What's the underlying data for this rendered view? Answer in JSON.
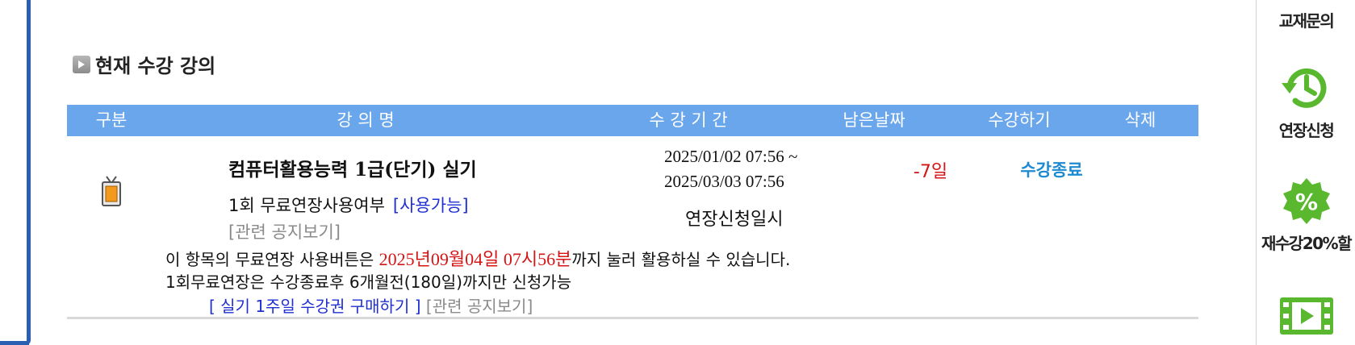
{
  "section": {
    "title": "현재 수강 강의"
  },
  "table": {
    "headers": [
      "구분",
      "강 의 명",
      "수 강 기 간",
      "남은날짜",
      "수강하기",
      "삭제"
    ]
  },
  "course": {
    "name": "컴퓨터활용능력 1급(단기) 실기",
    "extension_label": "1회 무료연장사용여부",
    "extension_status": "[사용가능]",
    "notice_link": "[관련 공지보기]",
    "period_start": "2025/01/02 07:56 ~",
    "period_end": "2025/03/03 07:56",
    "extension_date_label": "연장신청일시",
    "remaining": "-7일",
    "status": "수강종료",
    "info_prefix": "이 항목의 무료연장 사용버튼은 ",
    "info_date": "2025년09월04일 07시56분",
    "info_suffix": "까지 눌러 활용하실 수 있습니다.",
    "info_line2": "1회무료연장은 수강종료후 6개월전(180일)까지만 신청가능",
    "buy_link": "[ 실기 1주일 수강권 구매하기 ]",
    "notice_link2": "[관련 공지보기]"
  },
  "side_menu": {
    "items": [
      {
        "label": "교재문의",
        "icon": "book-inquiry-icon"
      },
      {
        "label": "연장신청",
        "icon": "clock-history-icon"
      },
      {
        "label": "재수강20%할",
        "icon": "percent-badge-icon"
      },
      {
        "label": "",
        "icon": "video-play-icon"
      }
    ]
  },
  "colors": {
    "header_bg": "#6aa6ec",
    "accent_red": "#d41515",
    "link_blue": "#1f2fd1",
    "status_blue": "#1d8ad1",
    "menu_green": "#5ab82e"
  }
}
